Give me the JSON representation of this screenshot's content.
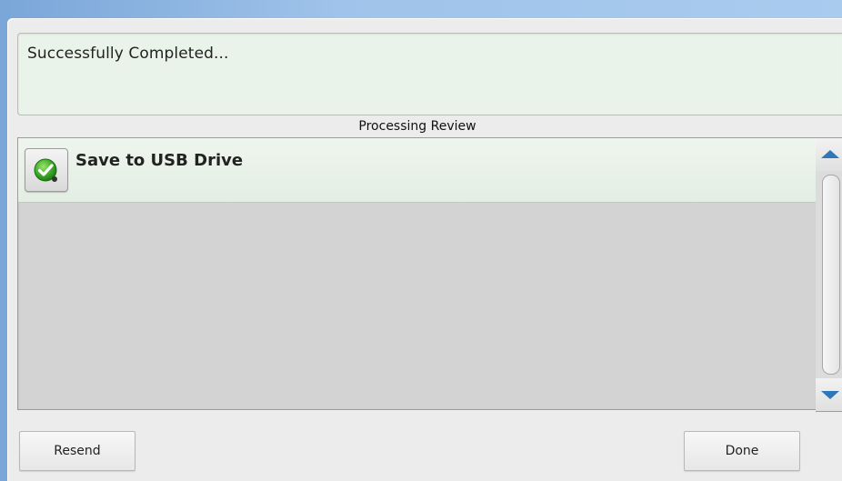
{
  "status": {
    "message": "Successfully Completed..."
  },
  "review": {
    "title": "Processing Review",
    "items": [
      {
        "label": "Save to USB Drive",
        "icon": "checkmark-success-icon",
        "state": "completed"
      }
    ]
  },
  "buttons": {
    "resend": "Resend",
    "done": "Done"
  },
  "colors": {
    "accent": "#2e77b9",
    "success": "#3fae2c",
    "background": "#a9cbee"
  }
}
